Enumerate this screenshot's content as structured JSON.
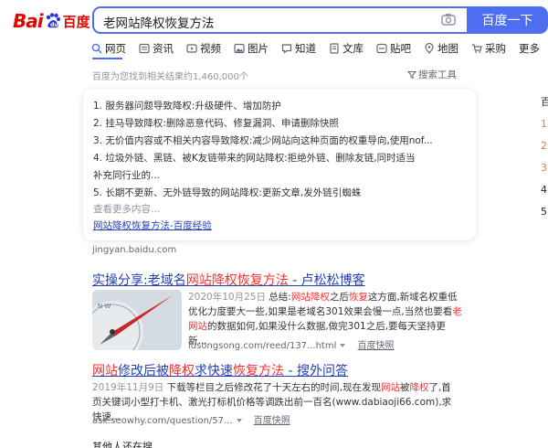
{
  "logo": {
    "left": "Bai",
    "right": "du",
    "cn": "百度"
  },
  "search": {
    "query": "老网站降权恢复方法",
    "button": "百度一下"
  },
  "tabs": [
    {
      "label": "网页",
      "icon": "search-icon"
    },
    {
      "label": "资讯",
      "icon": "news-icon"
    },
    {
      "label": "视频",
      "icon": "video-icon"
    },
    {
      "label": "图片",
      "icon": "image-icon"
    },
    {
      "label": "知道",
      "icon": "question-icon"
    },
    {
      "label": "文库",
      "icon": "document-icon"
    },
    {
      "label": "贴吧",
      "icon": "forum-icon"
    },
    {
      "label": "地图",
      "icon": "map-icon"
    },
    {
      "label": "采购",
      "icon": "cart-icon"
    },
    {
      "label": "更多",
      "icon": ""
    }
  ],
  "result_count": "百度为您找到相关结果约1,460,000个",
  "tools_label": "搜索工具",
  "right_col": {
    "head": "百",
    "nums": [
      "1",
      "2",
      "3",
      "4",
      "5"
    ]
  },
  "card": {
    "lines": [
      "1. 服务器问题导致降权:升级硬件、增加防护",
      "2. 挂马导致降权:删除恶意代码、修复漏洞、申请删除快照",
      "3. 无价值内容或不相关内容导致降权:减少网站向这种页面的权重导向,使用nof...",
      "4. 垃圾外链、黑链、被K友链带来的网站降权:拒绝外链、删除友链,同时适当补充同行业的...",
      "5. 长期不更新、无外链导致的网站降权:更新文章,发外链引蜘蛛"
    ],
    "more": "查看更多内容...",
    "source": "网站降权恢复方法-百度经验",
    "site": "jingyan.baidu.com"
  },
  "results": [
    {
      "title_pre": "实操分享:老域名",
      "title_em": "网站降权恢复方法",
      "title_post": " - 卢松松博客",
      "date": "2020年10月25日",
      "summary_a": "总结:",
      "summary_em1": "网站降权",
      "summary_b": "之后",
      "summary_em2": "恢复",
      "summary_c": "这方面,新域名权重低优化力度要大一些,如果是老域名301效果会慢一点,当然也要看",
      "summary_em3": "老网站",
      "summary_d": "的数据如何,如果没什么数据,做完301之后,要每天坚持更新...",
      "url": "lusongsong.com/reed/137...html",
      "snapshot": "百度快照"
    },
    {
      "title_pre": "",
      "title_em": "网站",
      "title_mid": "修改后被",
      "title_em2": "降权",
      "title_mid2": "求快速",
      "title_em3": "恢复方法",
      "title_post": " - 搜外问答",
      "date": "2019年11月9日",
      "summary_a": "下载等栏目之后修改花了十天左右的时间,现在发现",
      "summary_em1": "网站",
      "summary_b": "被",
      "summary_em2": "降权",
      "summary_c": "了,首页关键词小型打卡机、激光打标机价格等调跌出前一百名(www.dabiaoji66.com),求快速...",
      "url": "ask.seowhy.com/question/57...",
      "snapshot": "百度快照"
    }
  ],
  "bottom_heading": "其他人还在搜"
}
